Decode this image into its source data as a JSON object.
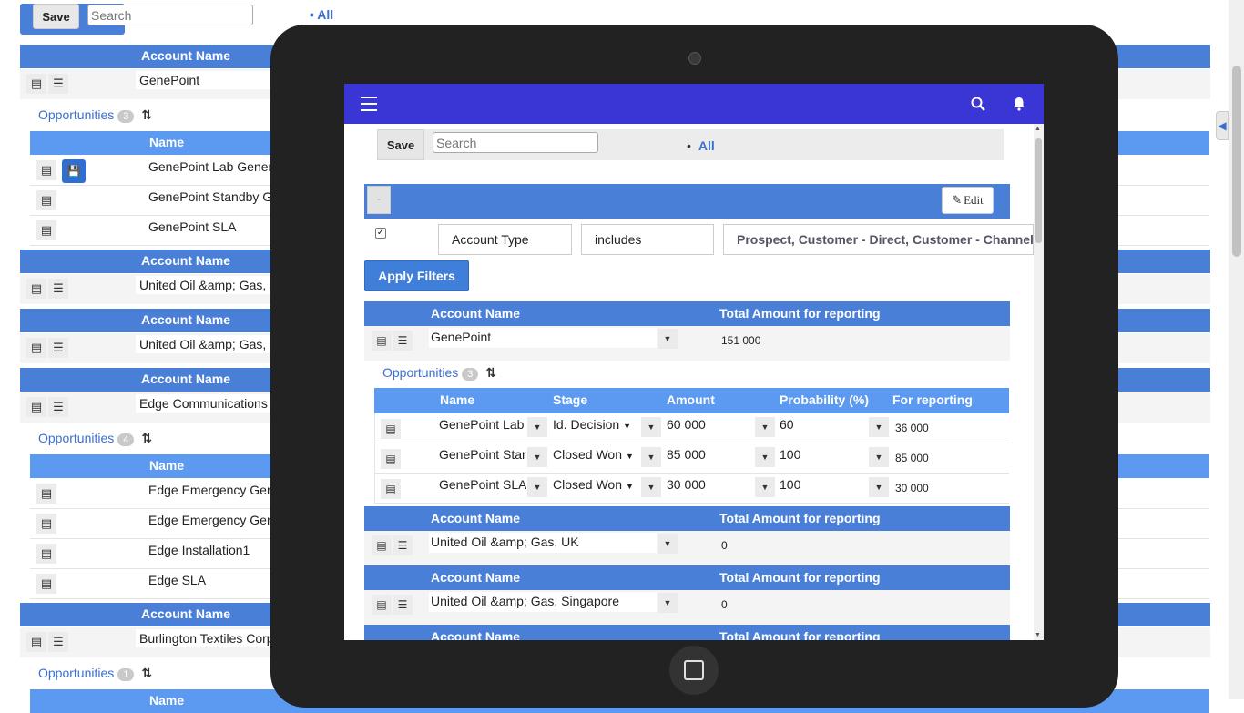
{
  "background": {
    "save_label": "Save",
    "search_placeholder": "Search",
    "filter_all": "All",
    "col_account_name": "Account Name",
    "col_name": "Name",
    "opportunities_label": "Opportunities",
    "accounts": [
      {
        "name": "GenePoint",
        "opp_count": "3",
        "opps": [
          "GenePoint Lab Gener",
          "GenePoint Standby G",
          "GenePoint SLA"
        ]
      },
      {
        "name": "United Oil &amp; Gas,"
      },
      {
        "name": "United Oil &amp; Gas,"
      },
      {
        "name": "Edge Communications",
        "opp_count": "4",
        "opps": [
          "Edge Emergency Ger",
          "Edge Emergency Ger",
          "Edge Installation1",
          "Edge SLA"
        ]
      },
      {
        "name": "Burlington Textiles Corp",
        "opp_count": "1",
        "next_header": "Name"
      }
    ]
  },
  "tablet": {
    "toolbar": {
      "save_label": "Save",
      "search_placeholder": "Search",
      "filter_all": "All"
    },
    "filter": {
      "collapse_label": "-",
      "edit_label": "Edit",
      "checked": true,
      "field": "Account Type",
      "operator": "includes",
      "values": "Prospect, Customer - Direct, Customer - Channel",
      "apply_label": "Apply Filters"
    },
    "columns": {
      "account_name": "Account Name",
      "total_amount": "Total Amount for reporting"
    },
    "accounts": [
      {
        "name": "GenePoint",
        "total": "151 000"
      },
      {
        "name": "United Oil &amp; Gas, UK",
        "total": "0"
      },
      {
        "name": "United Oil &amp; Gas, Singapore",
        "total": "0"
      }
    ],
    "opportunities": {
      "label": "Opportunities",
      "count": "3",
      "columns": {
        "name": "Name",
        "stage": "Stage",
        "amount": "Amount",
        "probability": "Probability (%)",
        "for_reporting": "For reporting"
      },
      "rows": [
        {
          "name": "GenePoint Lab",
          "stage": "Id. Decision",
          "amount": "60 000",
          "probability": "60",
          "for_reporting": "36 000"
        },
        {
          "name": "GenePoint Star",
          "stage": "Closed Won",
          "amount": "85 000",
          "probability": "100",
          "for_reporting": "85 000"
        },
        {
          "name": "GenePoint SLA",
          "stage": "Closed Won",
          "amount": "30 000",
          "probability": "100",
          "for_reporting": "30 000"
        }
      ]
    }
  },
  "colors": {
    "appbar": "#3a36d6",
    "header": "#4a7fd8",
    "subheader": "#5b9af0",
    "link": "#3a6fcf",
    "tablet_frame": "#222222"
  },
  "icons": [
    "menu-icon",
    "search-icon",
    "bell-icon",
    "record-icon",
    "list-icon",
    "sort-icon",
    "save-icon",
    "pencil-icon",
    "dropdown-icon",
    "home-button-icon"
  ]
}
